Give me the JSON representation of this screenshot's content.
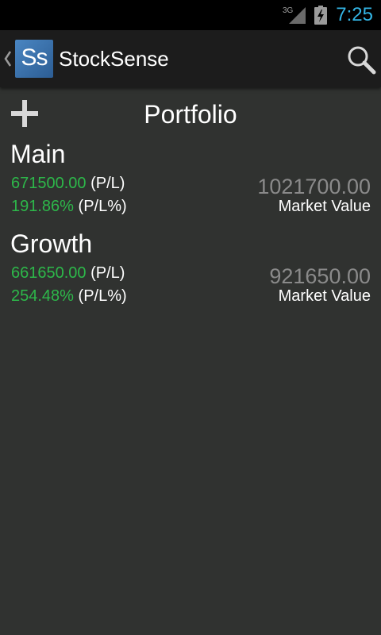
{
  "status_bar": {
    "network_label": "3G",
    "time": "7:25",
    "time_color": "#33b5e5",
    "icons": [
      "signal-3g-icon",
      "battery-charging-icon"
    ]
  },
  "action_bar": {
    "logo_text": "Ss",
    "title": "StockSense",
    "icons": [
      "up-caret-icon",
      "search-icon"
    ]
  },
  "header": {
    "add_icon": "plus-icon",
    "title": "Portfolio"
  },
  "portfolios": [
    {
      "name": "Main",
      "pl_value": "671500.00",
      "pl_suffix": "(P/L)",
      "pl_percent": "191.86%",
      "pl_percent_suffix": "(P/L%)",
      "market_value": "1021700.00",
      "market_value_label": "Market Value"
    },
    {
      "name": "Growth",
      "pl_value": "661650.00",
      "pl_suffix": "(P/L)",
      "pl_percent": "254.48%",
      "pl_percent_suffix": "(P/L%)",
      "market_value": "921650.00",
      "market_value_label": "Market Value"
    }
  ],
  "colors": {
    "gain_green": "#2db84a",
    "background": "#303230",
    "action_bar": "#1c1c1c"
  }
}
